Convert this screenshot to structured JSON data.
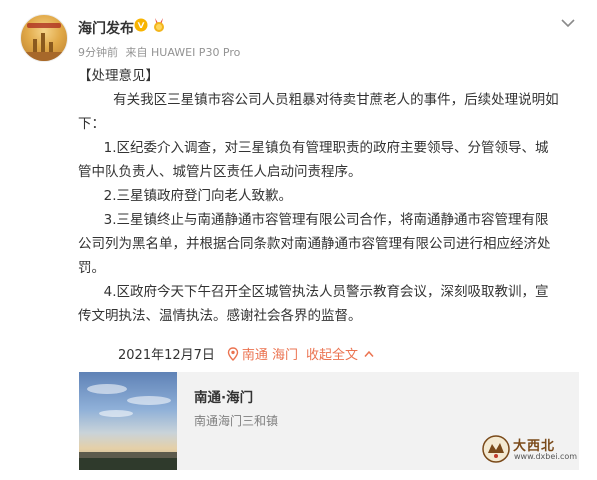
{
  "post": {
    "author": "海门发布",
    "time": "9分钟前",
    "source": "来自 HUAWEI P30 Pro",
    "title": "【处理意见】",
    "intro_line1": "有关我区三星镇市容公司人员粗暴对待卖甘蔗老人的事件，后续处理说明如",
    "intro_line2": "下：",
    "item1_line1": "1.区纪委介入调查，对三星镇负有管理职责的政府主要领导、分管领导、城",
    "item1_line2": "管中队负责人、城管片区责任人启动问责程序。",
    "item2_line1": "2.三星镇政府登门向老人致歉。",
    "item3_line1": "3.三星镇终止与南通静通市容管理有限公司合作，将南通静通市容管理有限",
    "item3_line2": "公司列为黑名单，并根据合同条款对南通静通市容管理有限公司进行相应经济处",
    "item3_line3": "罚。",
    "item4_line1": "4.区政府今天下午召开全区城管执法人员警示教育会议，深刻吸取教训，宣",
    "item4_line2": "传文明执法、温情执法。感谢社会各界的监督。",
    "date": "2021年12月7日",
    "location": "南通 海门",
    "collapse": "收起全文"
  },
  "place_card": {
    "title": "南通·海门",
    "subtitle": "南通海门三和镇"
  },
  "watermark": {
    "name": "大西北",
    "url": "www.dxbei.com"
  },
  "icons": {
    "avatar": "avatar-image",
    "verified": "verified-v-icon",
    "medal": "medal-badge-icon",
    "more": "chevron-down-icon",
    "location": "location-pin-icon",
    "collapse": "chevron-up-icon"
  },
  "colors": {
    "accent": "#eb7350",
    "verified": "#f8b400",
    "meta": "#939393",
    "card_bg": "#f2f2f2"
  }
}
